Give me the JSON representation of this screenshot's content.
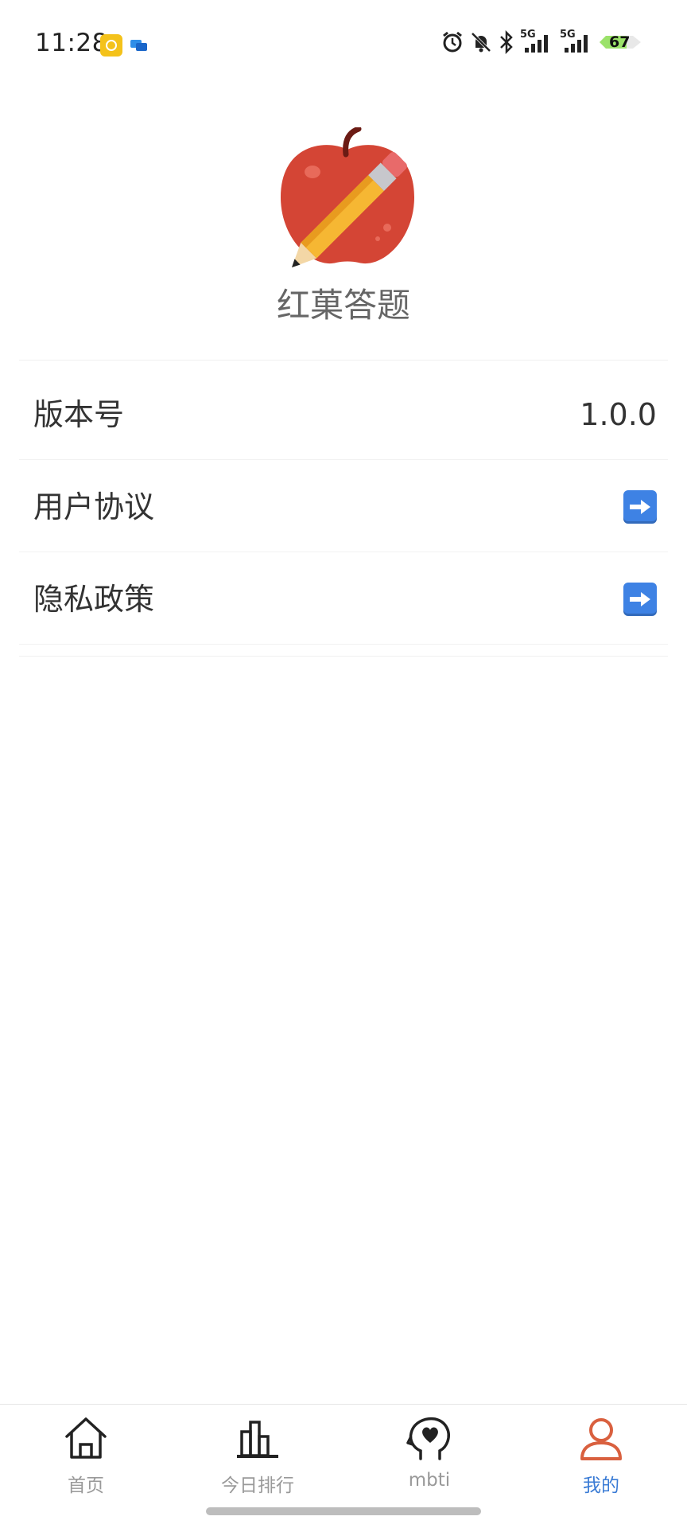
{
  "status_bar": {
    "time": "11:28",
    "network_1": "5G",
    "network_2": "5G",
    "battery_level": "67",
    "icons": [
      "app-notification-icon",
      "message-icon",
      "alarm-icon",
      "mute-icon",
      "bluetooth-icon",
      "signal-icon",
      "signal-icon",
      "battery-icon"
    ]
  },
  "header": {
    "app_name": "红菓答题",
    "logo": "apple-pencil-logo"
  },
  "settings": {
    "items": [
      {
        "label": "版本号",
        "value": "1.0.0"
      },
      {
        "label": "用户协议",
        "icon": "right-arrow-icon"
      },
      {
        "label": "隐私政策",
        "icon": "right-arrow-icon"
      }
    ]
  },
  "tab_bar": {
    "active_color": "#3a7bd5",
    "inactive_color": "#999999",
    "tabs": [
      {
        "label": "首页",
        "icon": "home-icon"
      },
      {
        "label": "今日排行",
        "icon": "bar-chart-icon"
      },
      {
        "label": "mbti",
        "icon": "head-heart-icon"
      },
      {
        "label": "我的",
        "icon": "user-icon",
        "active": true
      }
    ]
  }
}
